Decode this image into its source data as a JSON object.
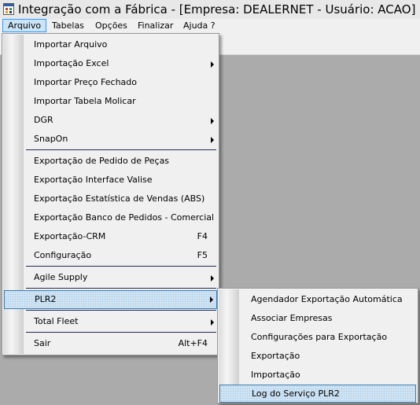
{
  "window": {
    "title": "Integração com a Fábrica - [Empresa: DEALERNET - Usuário: ACAO]",
    "icon": "app-icon"
  },
  "menubar": {
    "items": [
      {
        "label": "Arquivo",
        "active": true
      },
      {
        "label": "Tabelas"
      },
      {
        "label": "Opções"
      },
      {
        "label": "Finalizar"
      },
      {
        "label": "Ajuda ?"
      }
    ]
  },
  "arquivo_menu": {
    "items": [
      {
        "label": "Importar Arquivo"
      },
      {
        "label": "Importação Excel",
        "submenu": true
      },
      {
        "label": "Importar Preço Fechado"
      },
      {
        "label": "Importar Tabela Molicar"
      },
      {
        "label": "DGR",
        "submenu": true
      },
      {
        "label": "SnapOn",
        "submenu": true
      },
      {
        "label": "Exportação de Pedido de Peças"
      },
      {
        "label": "Exportação Interface Valise"
      },
      {
        "label": "Exportação Estatística de Vendas (ABS)"
      },
      {
        "label": "Exportação Banco de Pedidos - Comercial"
      },
      {
        "label": "Exportação-CRM",
        "shortcut": "F4"
      },
      {
        "label": "Configuração",
        "shortcut": "F5"
      },
      {
        "label": "Agile Supply",
        "submenu": true
      },
      {
        "label": "PLR2",
        "submenu": true,
        "highlighted": true
      },
      {
        "label": "Total Fleet",
        "submenu": true
      },
      {
        "label": "Sair",
        "shortcut": "Alt+F4"
      }
    ]
  },
  "plr2_submenu": {
    "items": [
      {
        "label": "Agendador Exportação Automática"
      },
      {
        "label": "Associar Empresas"
      },
      {
        "label": "Configurações para Exportação"
      },
      {
        "label": "Exportação"
      },
      {
        "label": "Importação"
      },
      {
        "label": "Log do Serviço PLR2",
        "highlighted": true
      }
    ]
  },
  "colors": {
    "menu_background": "#f0f0f0",
    "workspace": "#ababab",
    "highlight_border": "#3c7fb1",
    "highlight_fill": "#cfe3f3",
    "separator": "#1f2a55"
  }
}
